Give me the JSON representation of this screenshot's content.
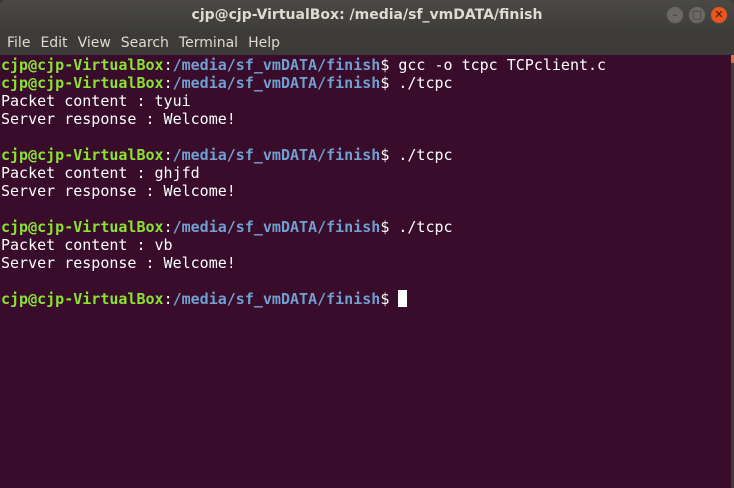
{
  "window": {
    "title": "cjp@cjp-VirtualBox: /media/sf_vmDATA/finish",
    "buttons": [
      "minimize",
      "maximize",
      "close"
    ]
  },
  "menu": [
    "File",
    "Edit",
    "View",
    "Search",
    "Terminal",
    "Help"
  ],
  "prompt": {
    "user": "cjp@cjp-VirtualBox",
    "sep": ":",
    "path": "/media/sf_vmDATA/finish",
    "sym": "$ "
  },
  "lines": [
    {
      "type": "cmd",
      "cmd": "gcc -o tcpc TCPclient.c"
    },
    {
      "type": "cmd",
      "cmd": "./tcpc"
    },
    {
      "type": "out",
      "text": "Packet content : tyui"
    },
    {
      "type": "out",
      "text": "Server response : Welcome!"
    },
    {
      "type": "out",
      "text": ""
    },
    {
      "type": "cmd",
      "cmd": "./tcpc"
    },
    {
      "type": "out",
      "text": "Packet content : ghjfd"
    },
    {
      "type": "out",
      "text": "Server response : Welcome!"
    },
    {
      "type": "out",
      "text": ""
    },
    {
      "type": "cmd",
      "cmd": "./tcpc"
    },
    {
      "type": "out",
      "text": "Packet content : vb"
    },
    {
      "type": "out",
      "text": "Server response : Welcome!"
    },
    {
      "type": "out",
      "text": ""
    },
    {
      "type": "cmd",
      "cmd": "",
      "cursor": true
    }
  ],
  "colors": {
    "background": "#380c2a",
    "user": "#8ae234",
    "path": "#729fcf",
    "close": "#e9541f"
  }
}
